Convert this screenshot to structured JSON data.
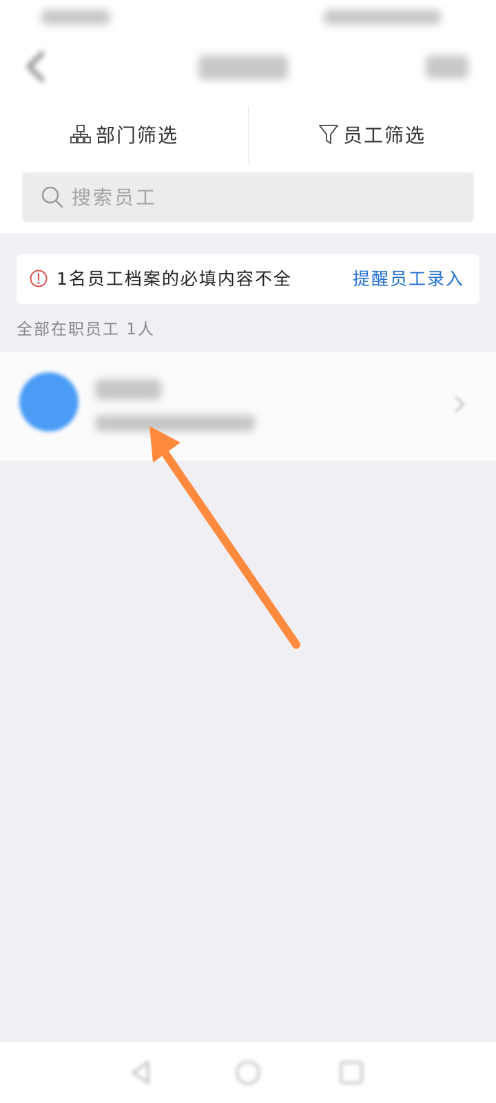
{
  "filters": {
    "department_label": "部门筛选",
    "employee_label": "员工筛选"
  },
  "search": {
    "placeholder": "搜索员工"
  },
  "alert": {
    "message": "1名员工档案的必填内容不全",
    "action_label": "提醒员工录入"
  },
  "list": {
    "count_label": "全部在职员工 1人"
  },
  "colors": {
    "accent_blue": "#1f6fd1",
    "alert_red": "#d9534f",
    "avatar_blue": "#4a9cf5",
    "annotation_orange": "#ff8a3d"
  },
  "icons": {
    "department": "org-chart-icon",
    "employee_filter": "funnel-icon",
    "search": "search-icon",
    "alert": "exclamation-circle-icon"
  }
}
